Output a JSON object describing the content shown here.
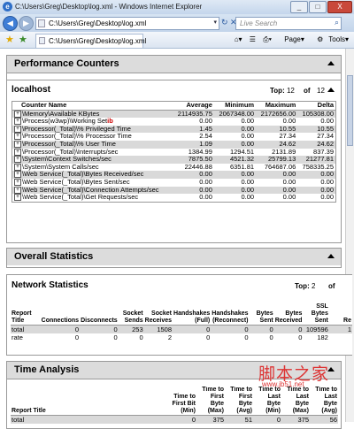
{
  "window": {
    "title": "C:\\Users\\Greg\\Desktop\\log.xml - Windows Internet Explorer",
    "buttons": [
      "_",
      "□",
      "X"
    ]
  },
  "address": {
    "url": "C:\\Users\\Greg\\Desktop\\log.xml",
    "search_placeholder": "Live Search"
  },
  "tab": {
    "label": "C:\\Users\\Greg\\Desktop\\log.xml"
  },
  "commands": {
    "page": "Page",
    "tools": "Tools"
  },
  "perf": {
    "title": "Performance Counters",
    "host": "localhost",
    "top_label": "Top:",
    "top_value": "12",
    "of_label": "of",
    "of_value": "12",
    "columns": [
      "Counter Name",
      "Average",
      "Minimum",
      "Maximum",
      "Delta"
    ],
    "rows": [
      [
        "\\Memory\\Available KBytes",
        "2114935.75",
        "2067348.00",
        "2172656.00",
        "105308.00"
      ],
      [
        "\\Process(w3wp)\\Working Set",
        "0.00",
        "0.00",
        "0.00",
        "0.00"
      ],
      [
        "\\Processor(_Total)\\% Privileged Time",
        "1.45",
        "0.00",
        "10.55",
        "10.55"
      ],
      [
        "\\Processor(_Total)\\% Processor Time",
        "2.54",
        "0.00",
        "27.34",
        "27.34"
      ],
      [
        "\\Processor(_Total)\\% User Time",
        "1.09",
        "0.00",
        "24.62",
        "24.62"
      ],
      [
        "\\Processor(_Total)\\Interrupts/sec",
        "1384.99",
        "1294.51",
        "2131.89",
        "837.39"
      ],
      [
        "\\System\\Context Switches/sec",
        "7875.50",
        "4521.32",
        "25799.13",
        "21277.81"
      ],
      [
        "\\System\\System Calls/sec",
        "22446.88",
        "6351.81",
        "764687.06",
        "758335.25"
      ],
      [
        "\\Web Service(_Total)\\Bytes Received/sec",
        "0.00",
        "0.00",
        "0.00",
        "0.00"
      ],
      [
        "\\Web Service(_Total)\\Bytes Sent/sec",
        "0.00",
        "0.00",
        "0.00",
        "0.00"
      ],
      [
        "\\Web Service(_Total)\\Connection Attempts/sec",
        "0.00",
        "0.00",
        "0.00",
        "0.00"
      ],
      [
        "\\Web Service(_Total)\\Get Requests/sec",
        "0.00",
        "0.00",
        "0.00",
        "0.00"
      ]
    ],
    "mark": "ib"
  },
  "overall": {
    "title": "Overall Statistics"
  },
  "network": {
    "title": "Network Statistics",
    "top_label": "Top:",
    "top_value": "2",
    "of_label": "of",
    "columns": [
      "Report Title",
      "Connections",
      "Disconnects",
      "Socket Sends",
      "Socket Receives",
      "Handshakes (Full)",
      "Handshakes (Reconnect)",
      "Bytes Sent",
      "Bytes Received",
      "SSL Bytes Sent",
      "Re"
    ],
    "rows": [
      [
        "total",
        "0",
        "0",
        "253",
        "1508",
        "0",
        "0",
        "0",
        "0",
        "109596",
        "1"
      ],
      [
        "rate",
        "0",
        "0",
        "0",
        "2",
        "0",
        "0",
        "0",
        "0",
        "182",
        ""
      ]
    ]
  },
  "time": {
    "title": "Time Analysis",
    "columns": [
      "Report Title",
      "Time to First Bit (Min)",
      "Time to First Byte (Max)",
      "Time to First Byte (Avg)",
      "Time to Last Byte (Min)",
      "Time to Last Byte (Max)",
      "Time to Last Byte (Avg)"
    ],
    "rows": [
      [
        "total",
        "0",
        "375",
        "51",
        "0",
        "375",
        "56"
      ]
    ]
  },
  "watermark": {
    "cn": "脚本之家",
    "url": "www.jb51.net"
  }
}
